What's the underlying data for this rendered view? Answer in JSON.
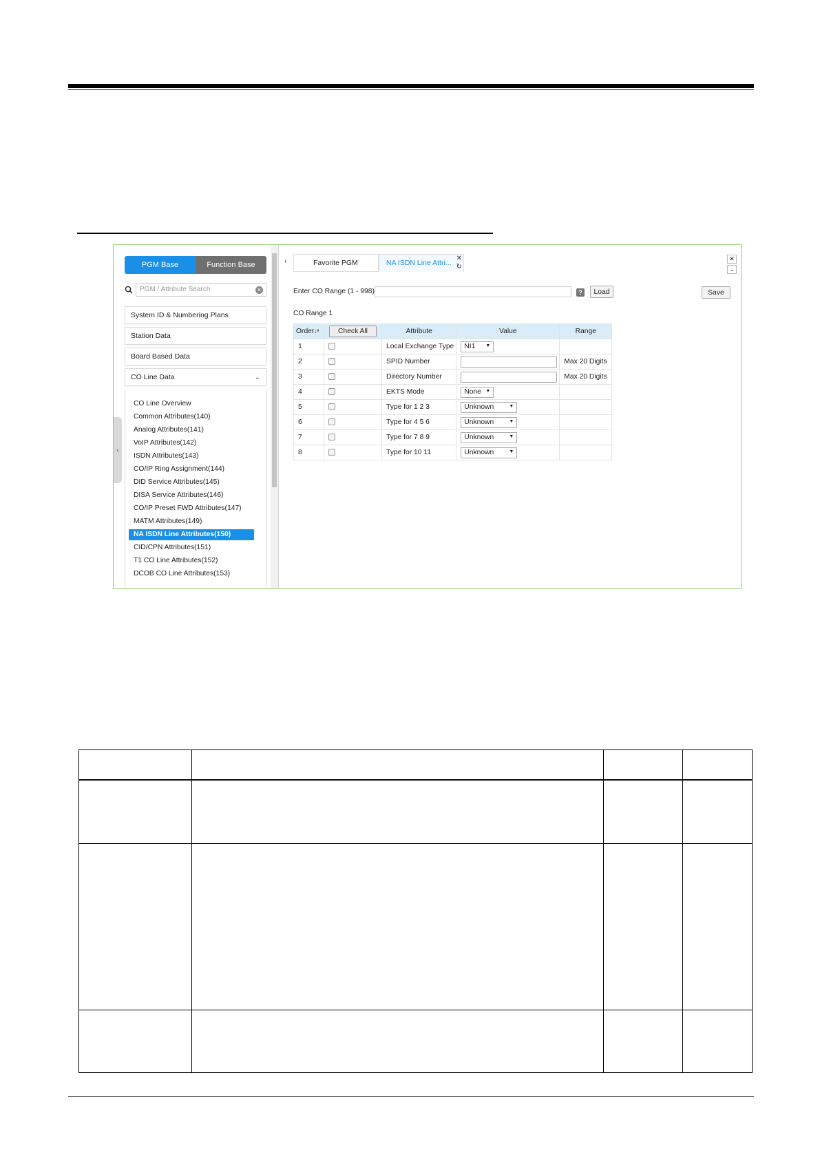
{
  "left_panel": {
    "pgm_base": "PGM Base",
    "function_base": "Function Base",
    "search_placeholder": "PGM / Attribute Search",
    "menus": [
      "System ID & Numbering Plans",
      "Station Data",
      "Board Based Data",
      "CO Line Data"
    ],
    "co_line_items": [
      "CO Line Overview",
      "Common Attributes(140)",
      "Analog Attributes(141)",
      "VoIP Attributes(142)",
      "ISDN Attributes(143)",
      "CO/IP Ring Assignment(144)",
      "DID Service Attributes(145)",
      "DISA Service Attributes(146)",
      "CO/IP Preset FWD Attributes(147)",
      "MATM Attributes(149)",
      "NA ISDN Line Attributes(150)",
      "CID/CPN Attributes(151)",
      "T1 CO Line Attributes(152)",
      "DCOB CO Line Attributes(153)"
    ],
    "selected_index": 10
  },
  "tabs": {
    "favorite": "Favorite PGM",
    "active": "NA ISDN Line Attri..."
  },
  "range": {
    "label": "Enter CO Range (1 - 998) :",
    "load": "Load",
    "save": "Save",
    "current": "CO Range 1"
  },
  "grid": {
    "headers": {
      "order": "Order",
      "check_all": "Check All",
      "attribute": "Attribute",
      "value": "Value",
      "range": "Range"
    },
    "rows": [
      {
        "order": "1",
        "attribute": "Local Exchange Type",
        "value": "NI1",
        "range": ""
      },
      {
        "order": "2",
        "attribute": "SPID Number",
        "value": "",
        "range": "Max 20 Digits"
      },
      {
        "order": "3",
        "attribute": "Directory Number",
        "value": "",
        "range": "Max 20 Digits"
      },
      {
        "order": "4",
        "attribute": "EKTS Mode",
        "value": "None",
        "range": ""
      },
      {
        "order": "5",
        "attribute": "Type for 1 2 3",
        "value": "Unknown",
        "range": ""
      },
      {
        "order": "6",
        "attribute": "Type for 4 5 6",
        "value": "Unknown",
        "range": ""
      },
      {
        "order": "7",
        "attribute": "Type for 7 8 9",
        "value": "Unknown",
        "range": ""
      },
      {
        "order": "8",
        "attribute": "Type for 10 11",
        "value": "Unknown",
        "range": ""
      }
    ]
  },
  "colors": {
    "accent": "#1a8fe8",
    "frame": "#8fd16a",
    "header_bg": "#d9ecf8"
  }
}
